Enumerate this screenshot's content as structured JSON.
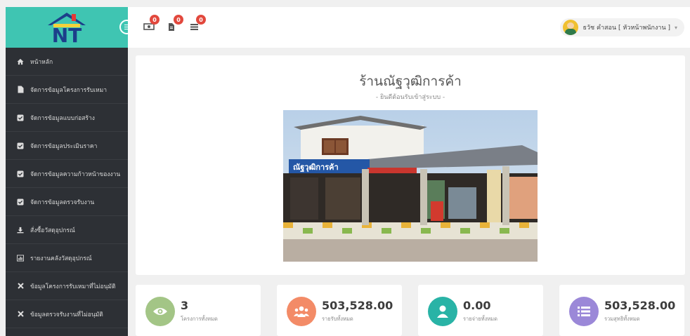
{
  "brand": {
    "logo_text": "NT",
    "color": "#3fc5b2"
  },
  "topbar": {
    "notifications": [
      {
        "icon": "money-icon",
        "count": "0"
      },
      {
        "icon": "document-icon",
        "count": "0"
      },
      {
        "icon": "list-icon",
        "count": "0"
      }
    ],
    "user_name": "ธวัช คำสอน [ หัวหน้าพนักงาน ]",
    "caret": "▾"
  },
  "sidebar": {
    "items": [
      {
        "icon": "home-icon",
        "label": "หน้าหลัก"
      },
      {
        "icon": "file-icon",
        "label": "จัดการข้อมูลโครงการรับเหมา"
      },
      {
        "icon": "checkbox-icon",
        "label": "จัดการข้อมูลแบบก่อสร้าง"
      },
      {
        "icon": "checkbox-icon",
        "label": "จัดการข้อมูลประเมินราคา"
      },
      {
        "icon": "checkbox-icon",
        "label": "จัดการข้อมูลความก้าวหน้าของงาน"
      },
      {
        "icon": "checkbox-icon",
        "label": "จัดการข้อมูลตรวจรับงาน"
      },
      {
        "icon": "download-icon",
        "label": "สั่งซื้อวัสดุอุปกรณ์"
      },
      {
        "icon": "chart-icon",
        "label": "รายงานคลังวัสดุอุปกรณ์"
      },
      {
        "icon": "x-icon",
        "label": "ข้อมูลโครงการรับเหมาที่ไม่อนุมัติ"
      },
      {
        "icon": "x-icon",
        "label": "ข้อมูลตรวจรับงานที่ไม่อนุมัติ"
      }
    ]
  },
  "hero": {
    "title": "ร้านณัฐวุฒิการค้า",
    "subtitle": "- ยินดีต้อนรับเข้าสู่ระบบ -",
    "sign_text": "ณัฐวุฒิการค้า"
  },
  "stats": [
    {
      "icon": "eye-icon",
      "color": "#a3c586",
      "value": "3",
      "label": "โครงการทั้งหมด"
    },
    {
      "icon": "users-icon",
      "color": "#f38b67",
      "value": "503,528.00",
      "label": "รายรับทั้งหมด"
    },
    {
      "icon": "user-icon",
      "color": "#29b3a6",
      "value": "0.00",
      "label": "รายจ่ายทั้งหมด"
    },
    {
      "icon": "list-icon",
      "color": "#9b88d8",
      "value": "503,528.00",
      "label": "รวมสุทธิทั้งหมด"
    }
  ]
}
